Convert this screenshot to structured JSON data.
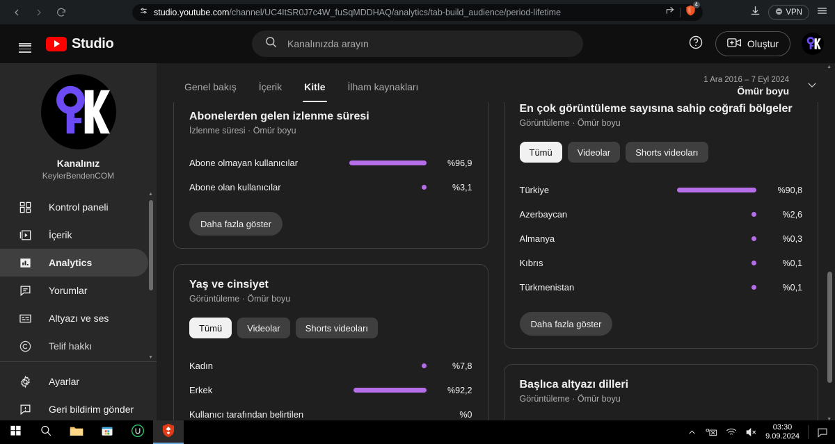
{
  "browser": {
    "back_icon": "back-arrow-icon",
    "forward_icon": "forward-arrow-icon",
    "reload_icon": "reload-icon",
    "url_host": "studio.youtube.com",
    "url_path": "/channel/UC4ItSR0J7c4W_fuSqMDDHAQ/analytics/tab-build_audience/period-lifetime",
    "share_icon": "share-icon",
    "shield_icon": "brave-shield-icon",
    "shield_count": "4",
    "download_icon": "download-icon",
    "vpn_label": "VPN",
    "menu_icon": "hamburger-menu-icon"
  },
  "header": {
    "menu_icon": "hamburger-menu-icon",
    "brand": "Studio",
    "search_placeholder": "Kanalınızda arayın",
    "search_value": "",
    "help_label": "?",
    "create_label": "Oluştur",
    "avatar": "channel-avatar"
  },
  "sidebar": {
    "channel_label": "Kanalınız",
    "channel_handle": "KeylerBendenCOM",
    "items": [
      {
        "label": "Kontrol paneli",
        "icon": "dashboard-icon",
        "active": false
      },
      {
        "label": "İçerik",
        "icon": "content-video-icon",
        "active": false
      },
      {
        "label": "Analytics",
        "icon": "analytics-bar-icon",
        "active": true
      },
      {
        "label": "Yorumlar",
        "icon": "comments-icon",
        "active": false
      },
      {
        "label": "Altyazı ve ses",
        "icon": "subtitles-icon",
        "active": false
      },
      {
        "label": "Telif hakkı",
        "icon": "copyright-icon",
        "active": false
      }
    ],
    "bottom_items": [
      {
        "label": "Ayarlar",
        "icon": "gear-icon"
      },
      {
        "label": "Geri bildirim gönder",
        "icon": "feedback-icon"
      }
    ]
  },
  "analytics": {
    "tabs": [
      {
        "label": "Genel bakış",
        "active": false
      },
      {
        "label": "İçerik",
        "active": false
      },
      {
        "label": "Kitle",
        "active": true
      },
      {
        "label": "İlham kaynakları",
        "active": false
      }
    ],
    "date_range": "1 Ara 2016 – 7 Eyl 2024",
    "date_preset": "Ömür boyu",
    "chevron_icon": "chevron-down-icon"
  },
  "chart_data": [
    {
      "type": "bar",
      "card_id": "subscriber-watch-time",
      "title": "Abonelerden gelen izlenme süresi",
      "subtitle": "İzlenme süresi · Ömür boyu",
      "categories": [
        "Abone olmayan kullanıcılar",
        "Abone olan kullanıcılar"
      ],
      "values": [
        96.9,
        3.1
      ],
      "value_labels": [
        "%96,9",
        "%3,1"
      ],
      "unit": "percent",
      "xlim": [
        0,
        100
      ],
      "grid": false,
      "legend": "none",
      "bar_color": "#b36ee8",
      "more_label": "Daha fazla göster"
    },
    {
      "type": "bar",
      "card_id": "age-and-gender",
      "title": "Yaş ve cinsiyet",
      "subtitle": "Görüntüleme · Ömür boyu",
      "chips": [
        {
          "label": "Tümü",
          "active": true
        },
        {
          "label": "Videolar",
          "active": false
        },
        {
          "label": "Shorts videoları",
          "active": false
        }
      ],
      "categories": [
        "Kadın",
        "Erkek",
        "Kullanıcı tarafından belirtilen"
      ],
      "values": [
        7.8,
        92.2,
        0
      ],
      "value_labels": [
        "%7,8",
        "%92,2",
        "%0"
      ],
      "unit": "percent",
      "xlim": [
        0,
        100
      ],
      "grid": false,
      "legend": "none",
      "bar_color": "#b36ee8"
    },
    {
      "type": "bar",
      "card_id": "top-geographies",
      "title": "En çok görüntüleme sayısına sahip coğrafi bölgeler",
      "subtitle": "Görüntüleme · Ömür boyu",
      "chips": [
        {
          "label": "Tümü",
          "active": true
        },
        {
          "label": "Videolar",
          "active": false
        },
        {
          "label": "Shorts videoları",
          "active": false
        }
      ],
      "categories": [
        "Türkiye",
        "Azerbaycan",
        "Almanya",
        "Kıbrıs",
        "Türkmenistan"
      ],
      "values": [
        90.8,
        2.6,
        0.3,
        0.1,
        0.1
      ],
      "value_labels": [
        "%90,8",
        "%2,6",
        "%0,3",
        "%0,1",
        "%0,1"
      ],
      "unit": "percent",
      "xlim": [
        0,
        100
      ],
      "grid": false,
      "legend": "none",
      "bar_color": "#b36ee8",
      "more_label": "Daha fazla göster"
    },
    {
      "type": "bar",
      "card_id": "top-subtitle-languages",
      "title": "Başlıca altyazı dilleri",
      "subtitle": "Görüntüleme · Ömür boyu",
      "categories": [],
      "values": [],
      "unit": "percent",
      "grid": false,
      "legend": "none",
      "bar_color": "#b36ee8"
    }
  ],
  "taskbar": {
    "items": [
      {
        "icon": "windows-start-icon",
        "active": false
      },
      {
        "icon": "search-icon",
        "active": false
      },
      {
        "icon": "file-explorer-icon",
        "active": false
      },
      {
        "icon": "microsoft-store-icon",
        "active": false
      },
      {
        "icon": "u-app-icon",
        "active": false
      },
      {
        "icon": "brave-browser-icon",
        "active": true
      }
    ],
    "tray": {
      "chevron_icon": "show-hidden-icons-icon",
      "keyboard_icon": "keyboard-language-icon",
      "wifi_icon": "wifi-icon",
      "volume_icon": "volume-muted-icon",
      "time": "03:30",
      "date": "9.09.2024",
      "action_center_icon": "action-center-icon"
    }
  },
  "colors": {
    "accent_bar": "#b36ee8",
    "brand_red": "#ff0000",
    "panel": "#1f1f1f",
    "sidebar": "#282828"
  }
}
